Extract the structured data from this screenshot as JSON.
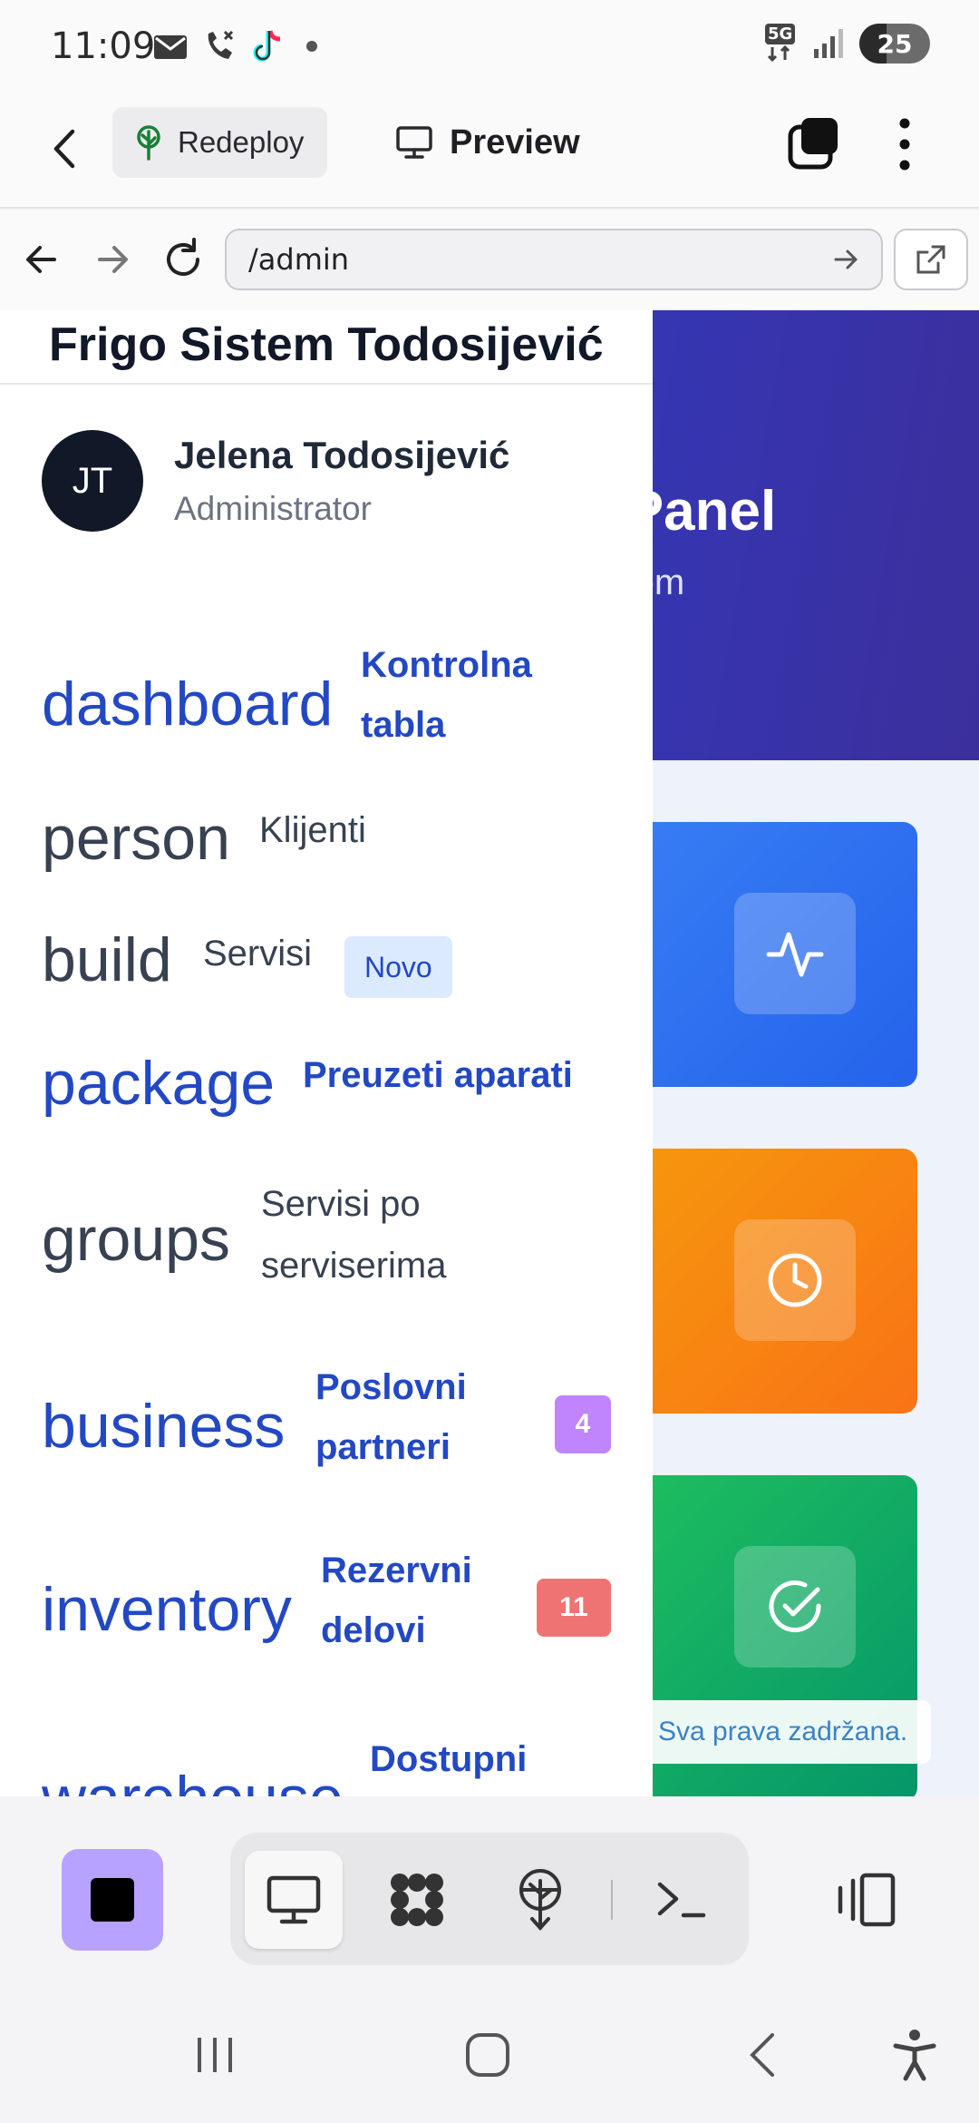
{
  "status_bar": {
    "time": "11:09",
    "network": "5G",
    "battery": "25"
  },
  "toolbar": {
    "redeploy_label": "Redeploy",
    "preview_label": "Preview"
  },
  "browser": {
    "url": "/admin"
  },
  "hero": {
    "title": "vni Panel",
    "subtitle": "sistemom"
  },
  "sidebar": {
    "brand": "Frigo Sistem Todosijević",
    "user": {
      "initials": "JT",
      "name": "Jelena Todosijević",
      "role": "Administrator"
    },
    "items": [
      {
        "icon": "dashboard",
        "label_line1": "Kontrolna",
        "label_line2": "tabla",
        "active": true
      },
      {
        "icon": "person",
        "label": "Klijenti",
        "active": false
      },
      {
        "icon": "build",
        "label": "Servisi",
        "badge": "Novo",
        "active": false
      },
      {
        "icon": "package",
        "label": "Preuzeti aparati",
        "active": true
      },
      {
        "icon": "groups",
        "label_line1": "Servisi po",
        "label_line2": "serviserima",
        "active": false
      },
      {
        "icon": "business",
        "label_line1": "Poslovni",
        "label_line2": "partneri",
        "count": "4",
        "count_color": "#c084fc",
        "active": true
      },
      {
        "icon": "inventory",
        "label_line1": "Rezervni",
        "label_line2": "delovi",
        "count": "11",
        "count_color": "#f07373",
        "active": true
      },
      {
        "icon": "warehouse",
        "label_line1": "Dostupni",
        "active": true
      }
    ]
  },
  "footer": {
    "note": "Sva prava zadržana."
  },
  "colors": {
    "accent": "#2248c4",
    "hero_gradient_start": "#2a47c6",
    "hero_gradient_end": "#3b2f9c",
    "card_blue": "#2563eb",
    "card_orange": "#f97316",
    "card_green": "#10b981",
    "stop_button": "#b8a2ff"
  }
}
